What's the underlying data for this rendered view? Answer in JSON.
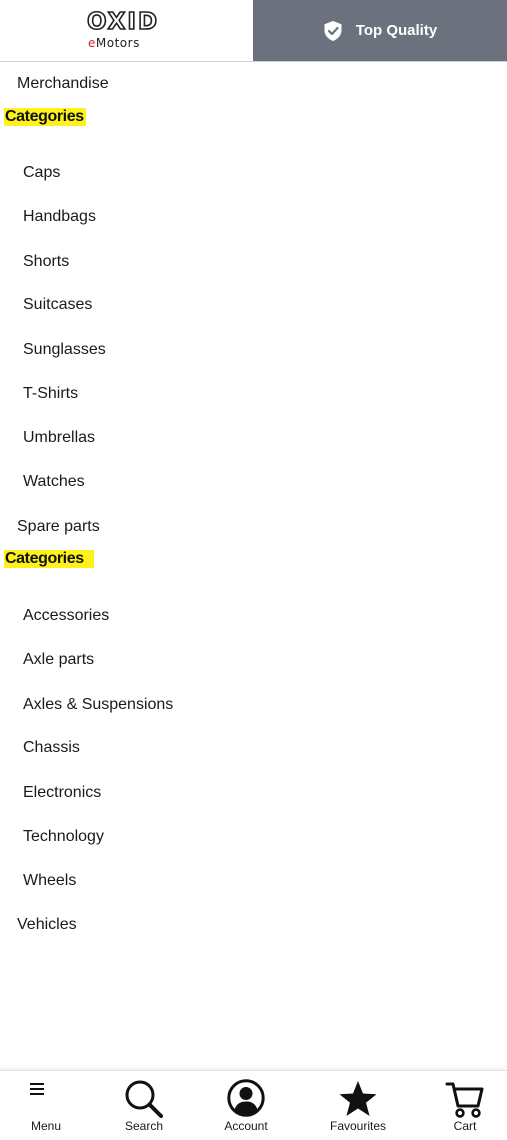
{
  "header": {
    "logo_main": "OXID",
    "logo_sub_e": "e",
    "logo_sub_rest": "Motors",
    "quality_label": "Top Quality",
    "quality_icon": "shield-check-icon"
  },
  "menu": {
    "merchandise": {
      "label": "Merchandise",
      "heading": "Categories",
      "items": [
        "Caps",
        "Handbags",
        "Shorts",
        "Suitcases",
        "Sunglasses",
        "T-Shirts",
        "Umbrellas",
        "Watches"
      ]
    },
    "spare_parts": {
      "label": "Spare parts",
      "heading": "Categories",
      "items": [
        "Accessories",
        "Axle parts",
        "Axles & Suspensions",
        "Chassis",
        "Electronics",
        "Technology",
        "Wheels"
      ]
    },
    "vehicles": {
      "label": "Vehicles"
    }
  },
  "bottom_nav": {
    "menu": {
      "label": "Menu",
      "icon": "hamburger-icon"
    },
    "search": {
      "label": "Search",
      "icon": "search-icon"
    },
    "account": {
      "label": "Account",
      "icon": "user-circle-icon"
    },
    "favourites": {
      "label": "Favourites",
      "icon": "star-icon"
    },
    "cart": {
      "label": "Cart",
      "icon": "cart-icon"
    }
  },
  "colors": {
    "highlight": "#fff21a",
    "quality_bg": "#6b717d",
    "logo_accent": "#d0242f"
  }
}
